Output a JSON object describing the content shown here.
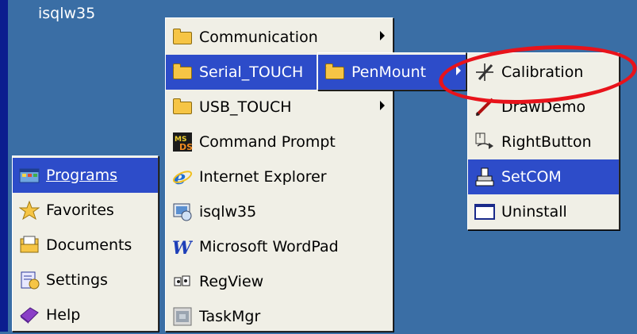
{
  "desktop": {
    "icon_label": "isqlw35"
  },
  "start_menu": {
    "items": [
      {
        "label": "Programs",
        "icon": "programs-icon",
        "highlighted": true
      },
      {
        "label": "Favorites",
        "icon": "star-icon"
      },
      {
        "label": "Documents",
        "icon": "documents-icon"
      },
      {
        "label": "Settings",
        "icon": "settings-icon"
      },
      {
        "label": "Help",
        "icon": "help-icon"
      }
    ]
  },
  "programs_menu": {
    "items": [
      {
        "label": "Communication",
        "icon": "folder-icon",
        "submenu": true
      },
      {
        "label": "Serial_TOUCH",
        "icon": "folder-icon",
        "submenu": true,
        "highlighted": true
      },
      {
        "label": "USB_TOUCH",
        "icon": "folder-icon",
        "submenu": true
      },
      {
        "label": "Command Prompt",
        "icon": "command-prompt-icon"
      },
      {
        "label": "Internet Explorer",
        "icon": "internet-explorer-icon"
      },
      {
        "label": "isqlw35",
        "icon": "isqlw35-icon"
      },
      {
        "label": "Microsoft WordPad",
        "icon": "wordpad-icon"
      },
      {
        "label": "RegView",
        "icon": "regview-icon"
      },
      {
        "label": "TaskMgr",
        "icon": "taskmgr-icon"
      }
    ]
  },
  "serial_touch_menu": {
    "items": [
      {
        "label": "PenMount",
        "icon": "folder-icon",
        "submenu": true,
        "highlighted": true
      }
    ]
  },
  "penmount_menu": {
    "items": [
      {
        "label": "Calibration",
        "icon": "calibration-icon"
      },
      {
        "label": "DrawDemo",
        "icon": "pen-icon"
      },
      {
        "label": "RightButton",
        "icon": "right-button-icon"
      },
      {
        "label": "SetCOM",
        "icon": "setcom-icon",
        "highlighted": true
      },
      {
        "label": "Uninstall",
        "icon": "uninstall-icon"
      }
    ]
  },
  "annotation": {
    "color": "#e8131b",
    "target": "Calibration"
  },
  "colors": {
    "desktop": "#3a6ea5",
    "menu_bg": "#f0efe6",
    "highlight": "#2d4cc9"
  }
}
